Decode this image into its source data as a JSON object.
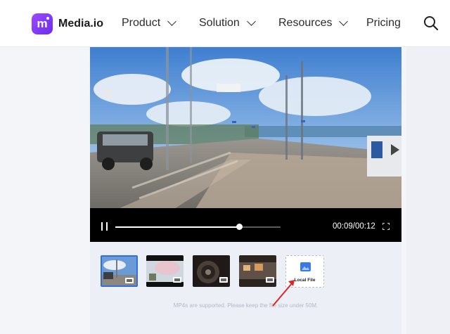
{
  "brand": {
    "name": "Media.io",
    "logo_letter": "m",
    "accent": "#7b3ff6"
  },
  "nav": {
    "items": [
      {
        "label": "Product",
        "has_dropdown": true
      },
      {
        "label": "Solution",
        "has_dropdown": true
      },
      {
        "label": "Resources",
        "has_dropdown": true
      },
      {
        "label": "Pricing",
        "has_dropdown": false
      }
    ],
    "search_icon": "search-icon"
  },
  "player": {
    "state": "playing",
    "current_time": "00:09",
    "duration": "00:12",
    "time_display": "00:09/00:12",
    "progress": 0.75,
    "icons": {
      "pause": "pause-icon",
      "fullscreen": "fullscreen-icon"
    }
  },
  "samples": {
    "thumbnails": [
      {
        "selected": true,
        "badge_icon": "film-icon"
      },
      {
        "selected": false,
        "badge_icon": "film-icon"
      },
      {
        "selected": false,
        "badge_icon": "film-icon"
      },
      {
        "selected": false,
        "badge_icon": "film-icon"
      }
    ],
    "local_file_label": "Local File",
    "local_file_icon": "upload-image-icon"
  },
  "hint_text": "MP4s are supported. Please keep the file size under 50M.",
  "colors": {
    "selected_border": "#2f6fe0",
    "annotation_arrow": "#e02424"
  }
}
